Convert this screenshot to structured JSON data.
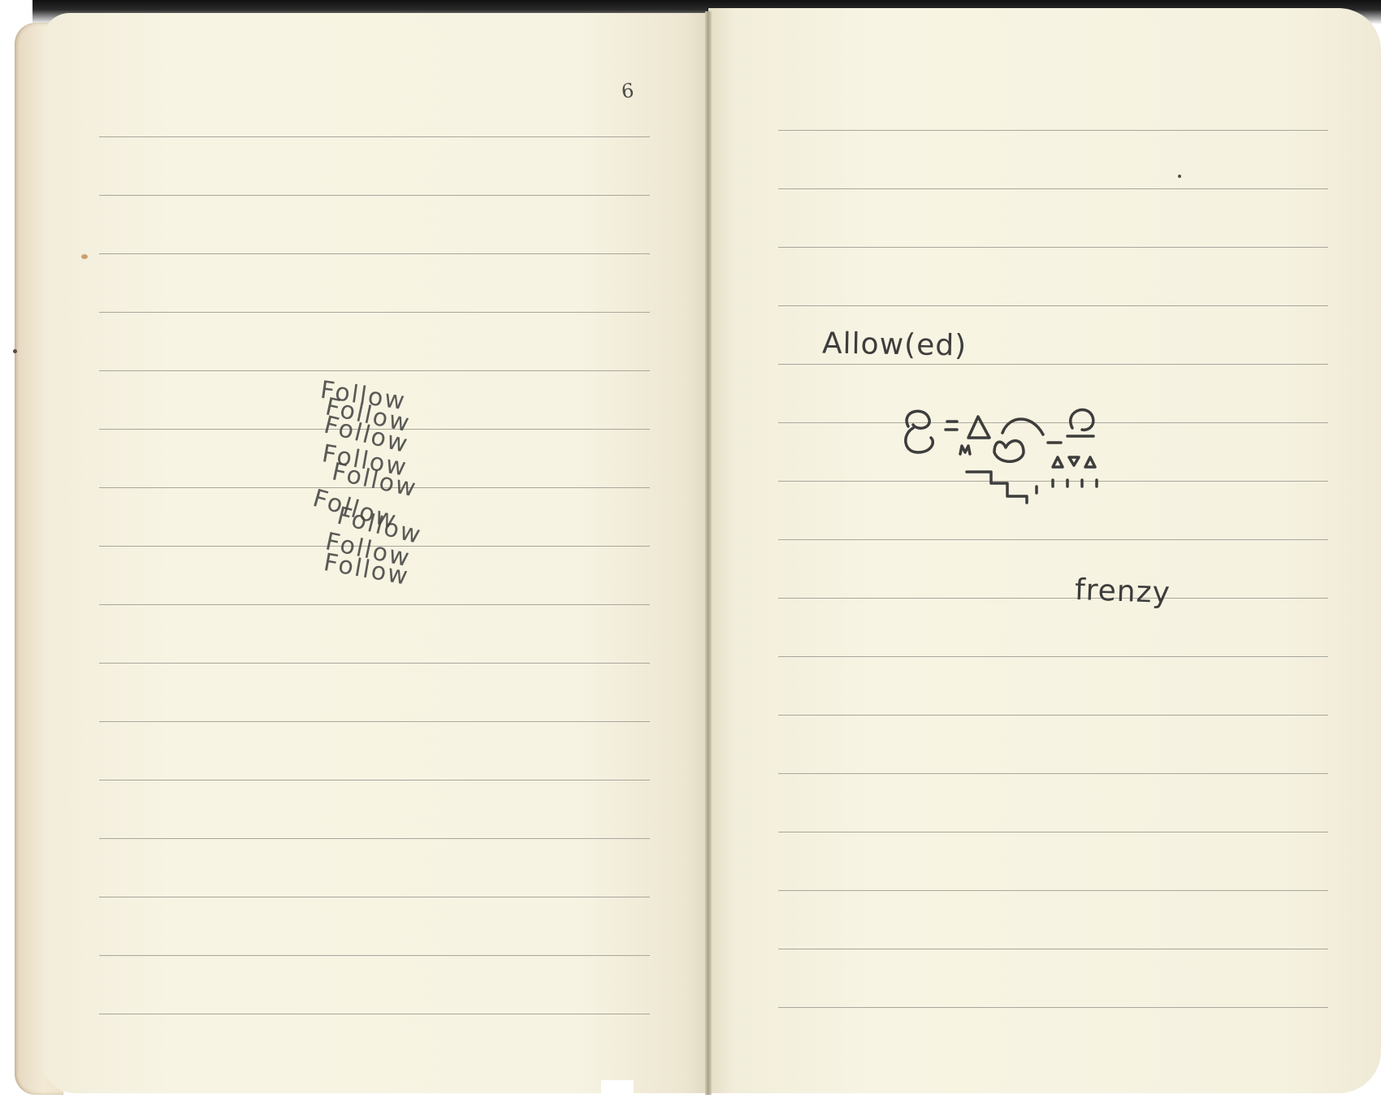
{
  "left_page": {
    "page_number": "6",
    "follow_words": [
      "Follow",
      "Follow",
      "Follow",
      "Follow",
      "Follow",
      "Follow",
      "Follow",
      "Follow",
      "Follow"
    ]
  },
  "right_page": {
    "heading": "Allow(ed)",
    "caption": "frenzy"
  },
  "colors": {
    "paper": "#f7f3e2",
    "rule_line": "#a8a79d",
    "pencil": "#3d3d3c"
  }
}
